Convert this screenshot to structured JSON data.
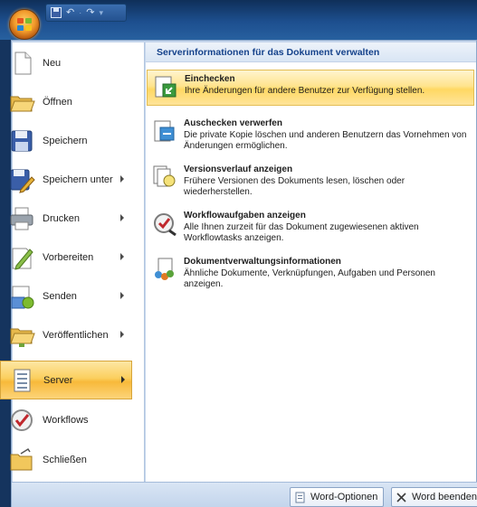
{
  "titlebar": {
    "quick_access": [
      "💾",
      "↶",
      "·",
      "↷",
      "▾"
    ]
  },
  "left_menu": {
    "items": [
      {
        "label": "Neu",
        "icon": "new-document-icon",
        "submenu": false
      },
      {
        "label": "Öffnen",
        "icon": "open-folder-icon",
        "submenu": false
      },
      {
        "label": "Speichern",
        "icon": "save-disk-icon",
        "submenu": false
      },
      {
        "label": "Speichern unter",
        "icon": "save-as-icon",
        "submenu": true
      },
      {
        "label": "Drucken",
        "icon": "printer-icon",
        "submenu": true
      },
      {
        "label": "Vorbereiten",
        "icon": "prepare-pencil-icon",
        "submenu": true
      },
      {
        "label": "Senden",
        "icon": "send-icon",
        "submenu": true
      },
      {
        "label": "Veröffentlichen",
        "icon": "publish-folder-icon",
        "submenu": true
      },
      {
        "label": "Server",
        "icon": "server-document-icon",
        "submenu": true,
        "selected": true
      },
      {
        "label": "Workflows",
        "icon": "workflows-check-icon",
        "submenu": false
      },
      {
        "label": "Schließen",
        "icon": "close-folder-icon",
        "submenu": false
      }
    ]
  },
  "right_pane": {
    "header": "Serverinformationen für das Dokument verwalten",
    "options": [
      {
        "title": "Einchecken",
        "description": "Ihre Änderungen für andere Benutzer zur Verfügung stellen.",
        "icon": "checkin-icon",
        "selected": true
      },
      {
        "title": "Auschecken verwerfen",
        "description": "Die private Kopie löschen und anderen Benutzern das Vornehmen von Änderungen ermöglichen.",
        "icon": "discard-checkout-icon"
      },
      {
        "title": "Versionsverlauf anzeigen",
        "description": "Frühere Versionen des Dokuments lesen, löschen oder wiederherstellen.",
        "icon": "version-history-icon"
      },
      {
        "title": "Workflowaufgaben anzeigen",
        "description": "Alle Ihnen zurzeit für das Dokument zugewiesenen aktiven Workflowtasks anzeigen.",
        "icon": "workflow-tasks-icon"
      },
      {
        "title": "Dokumentverwaltungsinformationen",
        "description": "Ähnliche Dokumente, Verknüpfungen, Aufgaben und Personen anzeigen.",
        "icon": "document-management-icon"
      }
    ]
  },
  "bottom_bar": {
    "options_label": "Word-Optionen",
    "exit_label": "Word beenden"
  },
  "colors": {
    "selected_gradient_mid": "#fbcf5e",
    "header_text": "#15428b",
    "title_bar": "#1d4f8f"
  }
}
